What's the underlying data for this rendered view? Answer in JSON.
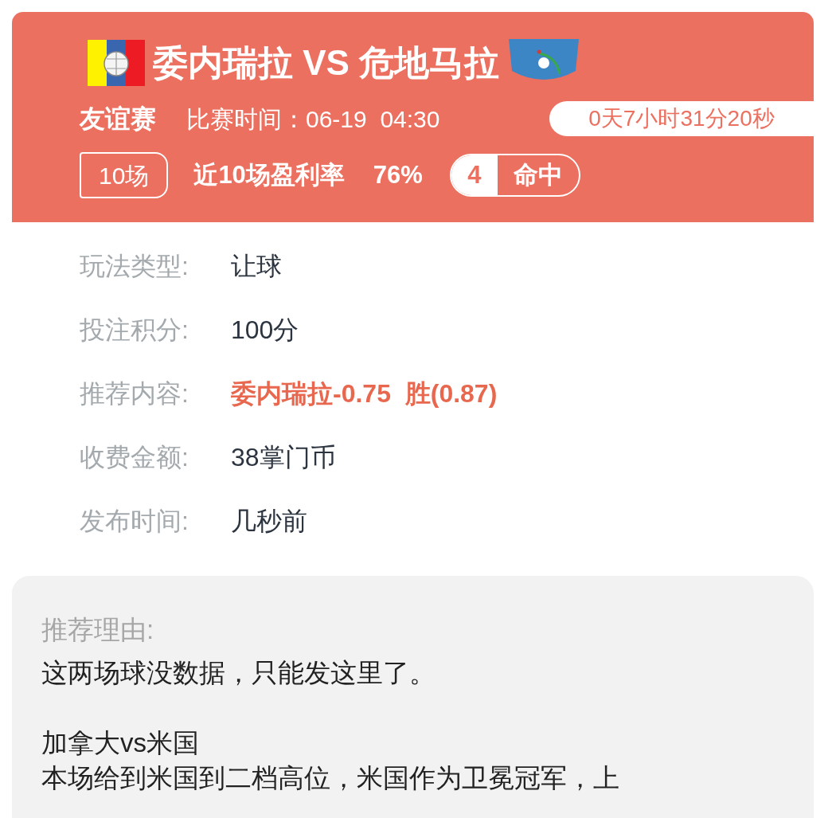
{
  "match": {
    "home_team": "委内瑞拉",
    "vs": "VS",
    "away_team": "危地马拉",
    "league": "友谊赛",
    "time_label": "比赛时间：",
    "time": "06-19  04:30",
    "countdown": "0天7小时31分20秒"
  },
  "stats": {
    "games_badge": "10场",
    "profit_label": "近10场盈利率",
    "profit_value": "76%",
    "hits_count": "4",
    "hits_label": "命中"
  },
  "details": [
    {
      "label": "玩法类型:",
      "value": "让球",
      "highlight": false
    },
    {
      "label": "投注积分:",
      "value": "100分",
      "highlight": false
    },
    {
      "label": "推荐内容:",
      "value": "委内瑞拉-0.75  胜(0.87)",
      "highlight": true
    },
    {
      "label": "收费金额:",
      "value": "38掌门币",
      "highlight": false
    },
    {
      "label": "发布时间:",
      "value": "几秒前",
      "highlight": false
    }
  ],
  "reason": {
    "title": "推荐理由:",
    "paragraphs": [
      [
        "这两场球没数据，只能发这里了。"
      ],
      [
        "加拿大vs米国",
        "本场给到米国到二档高位，米国作为卫冕冠军，上"
      ]
    ]
  }
}
